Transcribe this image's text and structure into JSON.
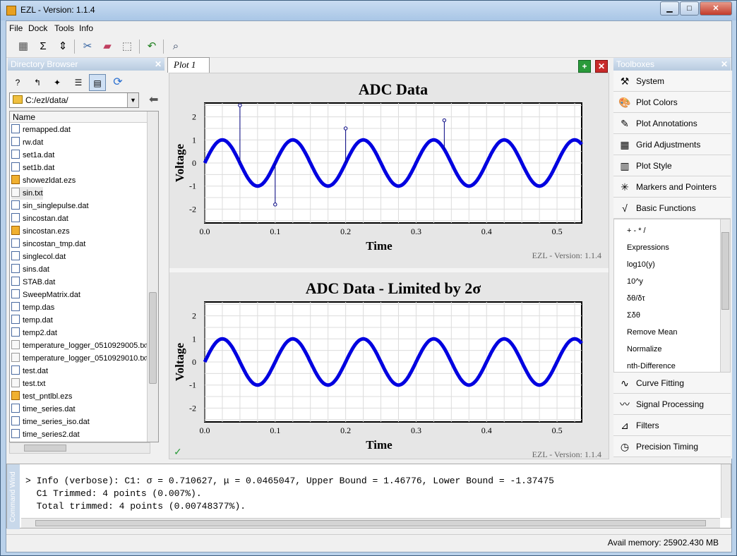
{
  "window": {
    "title": "EZL - Version: 1.1.4"
  },
  "menu": [
    "File",
    "Dock",
    "Tools",
    "Info"
  ],
  "directory_browser": {
    "title": "Directory Browser",
    "path": "C:/ezl/data/",
    "column_header": "Name",
    "files": [
      {
        "name": "remapped.dat",
        "type": "dat"
      },
      {
        "name": "rw.dat",
        "type": "dat"
      },
      {
        "name": "set1a.dat",
        "type": "dat"
      },
      {
        "name": "set1b.dat",
        "type": "dat"
      },
      {
        "name": "showezldat.ezs",
        "type": "ezs"
      },
      {
        "name": "sin.txt",
        "type": "txt"
      },
      {
        "name": "sin_singlepulse.dat",
        "type": "dat"
      },
      {
        "name": "sincostan.dat",
        "type": "dat"
      },
      {
        "name": "sincostan.ezs",
        "type": "ezs"
      },
      {
        "name": "sincostan_tmp.dat",
        "type": "dat"
      },
      {
        "name": "singlecol.dat",
        "type": "dat"
      },
      {
        "name": "sins.dat",
        "type": "dat"
      },
      {
        "name": "STAB.dat",
        "type": "dat"
      },
      {
        "name": "SweepMatrix.dat",
        "type": "dat"
      },
      {
        "name": "temp.das",
        "type": "dat"
      },
      {
        "name": "temp.dat",
        "type": "dat"
      },
      {
        "name": "temp2.dat",
        "type": "dat"
      },
      {
        "name": "temperature_logger_0510929005.txt",
        "type": "txt"
      },
      {
        "name": "temperature_logger_0510929010.txt",
        "type": "txt"
      },
      {
        "name": "test.dat",
        "type": "dat"
      },
      {
        "name": "test.txt",
        "type": "txt"
      },
      {
        "name": "test_pntlbl.ezs",
        "type": "ezs"
      },
      {
        "name": "time_series.dat",
        "type": "dat"
      },
      {
        "name": "time_series_iso.dat",
        "type": "dat"
      },
      {
        "name": "time_series2.dat",
        "type": "dat"
      }
    ]
  },
  "plot_tab": "Plot 1",
  "chart_data": [
    {
      "type": "line",
      "title": "ADC Data",
      "xlabel": "Time",
      "ylabel": "Voltage",
      "xlim": [
        0,
        0.535
      ],
      "ylim": [
        -2.6,
        2.6
      ],
      "xticks": [
        "0.0",
        "0.1",
        "0.2",
        "0.3",
        "0.4",
        "0.5"
      ],
      "yticks": [
        "2",
        "1",
        "0",
        "-1",
        "-2"
      ],
      "watermark": "EZL - Version: 1.1.4",
      "series": [
        {
          "frequency_hz": 10,
          "amplitude": 1,
          "color": "#0000e0"
        }
      ],
      "outliers": [
        {
          "x": 0.05,
          "y": 2.5
        },
        {
          "x": 0.1,
          "y": -1.8
        },
        {
          "x": 0.2,
          "y": 1.5
        },
        {
          "x": 0.34,
          "y": 1.85
        }
      ]
    },
    {
      "type": "line",
      "title": "ADC Data - Limited by 2σ",
      "xlabel": "Time",
      "ylabel": "Voltage",
      "xlim": [
        0,
        0.535
      ],
      "ylim": [
        -2.6,
        2.6
      ],
      "xticks": [
        "0.0",
        "0.1",
        "0.2",
        "0.3",
        "0.4",
        "0.5"
      ],
      "yticks": [
        "2",
        "1",
        "0",
        "-1",
        "-2"
      ],
      "watermark": "EZL - Version: 1.1.4",
      "series": [
        {
          "frequency_hz": 10,
          "amplitude": 1,
          "color": "#0000e0"
        }
      ]
    }
  ],
  "toolboxes": {
    "title": "Toolboxes",
    "items_top": [
      {
        "label": "System",
        "icon": "tools-icon"
      },
      {
        "label": "Plot Colors",
        "icon": "palette-icon"
      },
      {
        "label": "Plot Annotations",
        "icon": "pen-icon"
      },
      {
        "label": "Grid Adjustments",
        "icon": "grid-icon"
      },
      {
        "label": "Plot Style",
        "icon": "bars-icon"
      },
      {
        "label": "Markers and Pointers",
        "icon": "marker-icon"
      },
      {
        "label": "Basic Functions",
        "icon": "function-icon"
      }
    ],
    "functions": [
      "+ - * /",
      "Expressions",
      "log10(y)",
      "10^y",
      "δθ/δτ",
      "Σδθ",
      "Remove Mean",
      "Normalize",
      "nth-Difference"
    ],
    "items_bottom": [
      {
        "label": "Curve Fitting",
        "icon": "curve-icon"
      },
      {
        "label": "Signal Processing",
        "icon": "signal-icon"
      },
      {
        "label": "Filters",
        "icon": "filter-icon"
      },
      {
        "label": "Precision Timing",
        "icon": "clock-icon"
      }
    ]
  },
  "command_window": {
    "tab": "Command Wind",
    "lines": [
      "> Info (verbose): C1: σ = 0.710627, μ = 0.0465047, Upper Bound = 1.46776, Lower Bound = -1.37475",
      "  C1 Trimmed: 4 points (0.007%).",
      "  Total trimmed: 4 points (0.00748377%)."
    ]
  },
  "status": {
    "memory": "Avail memory: 25902.430 MB"
  },
  "colors": {
    "series": "#0000e0",
    "accent": "#b9d1ea"
  }
}
